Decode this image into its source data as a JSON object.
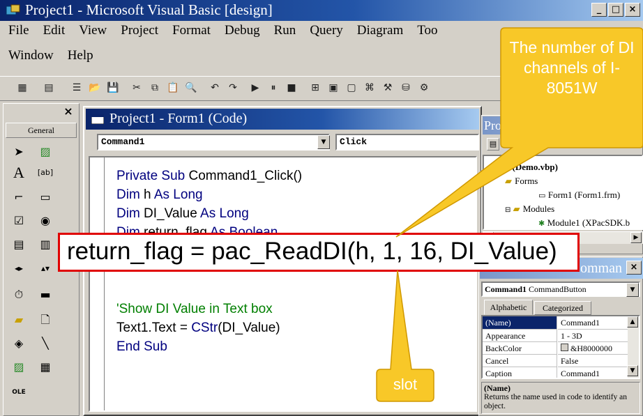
{
  "window": {
    "title": "Project1 - Microsoft Visual Basic [design]",
    "buttons": {
      "minimize": "_",
      "maximize": "□",
      "close": "×"
    }
  },
  "menu": {
    "row1": [
      "File",
      "Edit",
      "View",
      "Project",
      "Format",
      "Debug",
      "Run",
      "Query",
      "Diagram",
      "Too"
    ],
    "row2": [
      "Window",
      "Help"
    ]
  },
  "toolbox": {
    "title": "General",
    "close": "×"
  },
  "code_window": {
    "title": "Project1 - Form1 (Code)",
    "object_combo": "Command1",
    "procedure_combo": "Click",
    "code": {
      "l1_kw": "Private Sub",
      "l1_rest": " Command1_Click()",
      "l2_a": "Dim",
      "l2_b": " h ",
      "l2_c": "As Long",
      "l3_a": "Dim",
      "l3_b": " DI_Value ",
      "l3_c": "As Long",
      "l4_a": "Dim",
      "l4_b": " return_flag ",
      "l4_c": "As Boolean",
      "highlight": "return_flag = pac_ReadDI(h, 1, 16, DI_Value)",
      "comment": "'Show DI Value in Text box",
      "l7_a": "Text1.Text = ",
      "l7_b": "CStr",
      "l7_c": "(DI_Value)",
      "l8": "End Sub"
    }
  },
  "project_explorer": {
    "title": "Pro",
    "root": "1 (Demo.vbp)",
    "forms_folder": "Forms",
    "form_item": "Form1 (Form1.frm)",
    "modules_folder": "Modules",
    "module_item": "Module1 (XPacSDK.b"
  },
  "properties": {
    "title": "omman",
    "object_combo_name": "Command1",
    "object_combo_type": "CommandButton",
    "tabs": [
      "Alphabetic",
      "Categorized"
    ],
    "rows": [
      {
        "name": "(Name)",
        "value": "Command1"
      },
      {
        "name": "Appearance",
        "value": "1 - 3D"
      },
      {
        "name": "BackColor",
        "value": "&H8000000"
      },
      {
        "name": "Cancel",
        "value": "False"
      },
      {
        "name": "Caption",
        "value": "Command1"
      }
    ],
    "desc_title": "(Name)",
    "desc_text": "Returns the name used in code to identify an object."
  },
  "callouts": {
    "top": "The number of DI channels of I-8051W",
    "bottom": "slot"
  },
  "colors": {
    "callout_fill": "#f8c828",
    "callout_border": "#e0a000",
    "highlight_border": "#e00000",
    "keyword": "#00007f",
    "comment": "#007f00",
    "titlebar": "#0a246a"
  }
}
